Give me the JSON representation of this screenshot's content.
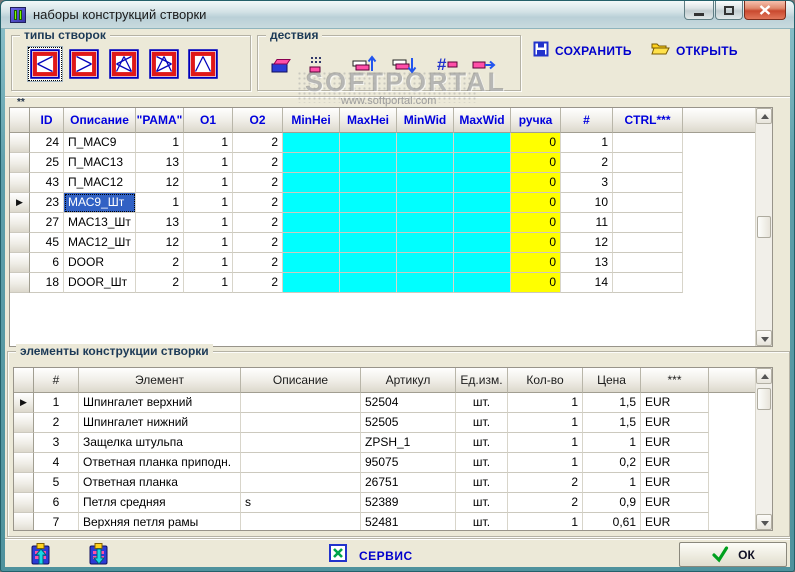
{
  "window": {
    "title": "наборы конструкций створки"
  },
  "toolbar": {
    "sash_types": {
      "label": "типы створок",
      "selected_index": 0,
      "buttons": [
        {
          "icon": "sash-turn-left-icon"
        },
        {
          "icon": "sash-turn-right-icon"
        },
        {
          "icon": "sash-tilt-turn-left-icon"
        },
        {
          "icon": "sash-tilt-turn-right-icon"
        },
        {
          "icon": "sash-tilt-icon"
        }
      ]
    },
    "actions": {
      "label": "дествия",
      "buttons": [
        {
          "icon": "copy-set-icon"
        },
        {
          "icon": "paste-grid-icon"
        },
        {
          "icon": "rows-move-up-icon"
        },
        {
          "icon": "rows-move-down-icon"
        },
        {
          "icon": "renumber-icon"
        },
        {
          "icon": "export-row-icon"
        }
      ]
    },
    "save_label": "СОХРАНИТЬ",
    "open_label": "ОТКРЫТЬ"
  },
  "watermark": {
    "title": "SOFTPORTAL",
    "url": "www.softportal.com"
  },
  "grid_note": "**",
  "sets_table": {
    "headers": [
      "ID",
      "Описание",
      "\"РАМА\"",
      "O1",
      "O2",
      "MinHei",
      "MaxHei",
      "MinWid",
      "MaxWid",
      "ручка",
      "#",
      "CTRL***"
    ],
    "rows": [
      [
        "24",
        "П_МАС9",
        "1",
        "1",
        "2",
        "",
        "",
        "",
        "",
        "0",
        "1",
        ""
      ],
      [
        "25",
        "П_МАС13",
        "13",
        "1",
        "2",
        "",
        "",
        "",
        "",
        "0",
        "2",
        ""
      ],
      [
        "43",
        "П_МАС12",
        "12",
        "1",
        "2",
        "",
        "",
        "",
        "",
        "0",
        "3",
        ""
      ],
      [
        "23",
        "МАС9_Шт",
        "1",
        "1",
        "2",
        "",
        "",
        "",
        "",
        "0",
        "10",
        ""
      ],
      [
        "27",
        "МАС13_Шт",
        "13",
        "1",
        "2",
        "",
        "",
        "",
        "",
        "0",
        "11",
        ""
      ],
      [
        "45",
        "МАС12_Шт",
        "12",
        "1",
        "2",
        "",
        "",
        "",
        "",
        "0",
        "12",
        ""
      ],
      [
        "6",
        "DOOR",
        "2",
        "1",
        "2",
        "",
        "",
        "",
        "",
        "0",
        "13",
        ""
      ],
      [
        "18",
        "DOOR_Шт",
        "2",
        "1",
        "2",
        "",
        "",
        "",
        "",
        "0",
        "14",
        ""
      ]
    ],
    "selection": {
      "row": 3,
      "col": 1
    }
  },
  "elements_group": {
    "label": "элементы конструкции створки",
    "headers": [
      "#",
      "Элемент",
      "Описание",
      "Артикул",
      "Ед.изм.",
      "Кол-во",
      "Цена",
      "***"
    ],
    "rows": [
      [
        "1",
        "Шпингалет верхний",
        "",
        "52504",
        "шт.",
        "1",
        "1,5",
        "EUR"
      ],
      [
        "2",
        "Шпингалет нижний",
        "",
        "52505",
        "шт.",
        "1",
        "1,5",
        "EUR"
      ],
      [
        "3",
        "Защелка штульпа",
        "",
        "ZPSH_1",
        "шт.",
        "1",
        "1",
        "EUR"
      ],
      [
        "4",
        "Ответная планка приподн.",
        "",
        "95075",
        "шт.",
        "1",
        "0,2",
        "EUR"
      ],
      [
        "5",
        "Ответная планка",
        "",
        "26751",
        "шт.",
        "2",
        "1",
        "EUR"
      ],
      [
        "6",
        "Петля средняя",
        "s",
        "52389",
        "шт.",
        "2",
        "0,9",
        "EUR"
      ],
      [
        "7",
        "Верхняя петля рамы",
        "",
        "52481",
        "шт.",
        "1",
        "0,61",
        "EUR"
      ]
    ],
    "current_row": 0
  },
  "footer": {
    "service_label": "СЕРВИС",
    "ok_label": "ОК"
  },
  "colors": {
    "cyan": "#00ffff",
    "yellow": "#ffff00",
    "selection": "#3161c4",
    "grid1_header_text": "#0000dd",
    "link_text": "#0000cc"
  }
}
